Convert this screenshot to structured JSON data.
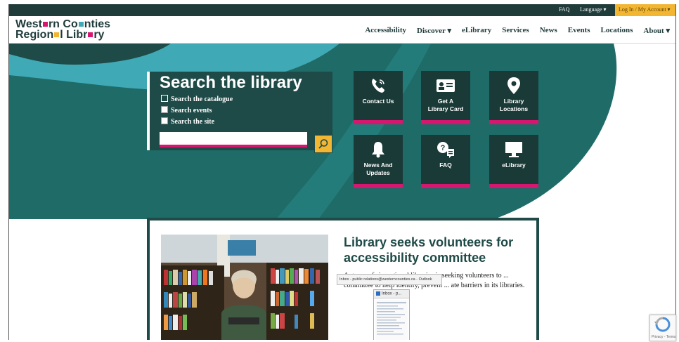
{
  "utility_bar": {
    "faq": "FAQ",
    "language": "Language ▾",
    "login": "Log In / My Account ▾"
  },
  "logo": {
    "line1_a": "West",
    "line1_b": "rn Co",
    "line1_c": "nties",
    "line2_a": "Region",
    "line2_b": "l Libr",
    "line2_c": "ry"
  },
  "nav": [
    "Accessibility",
    "Discover ▾",
    "eLibrary",
    "Services",
    "News",
    "Events",
    "Locations",
    "About ▾"
  ],
  "search": {
    "title": "Search the library",
    "options": [
      "Search the catalogue",
      "Search events",
      "Search the site"
    ],
    "placeholder": ""
  },
  "tiles": [
    {
      "label": "Contact Us",
      "icon": "phone-icon"
    },
    {
      "label": "Get A\nLibrary Card",
      "icon": "id-card-icon"
    },
    {
      "label": "Library\nLocations",
      "icon": "map-pin-icon"
    },
    {
      "label": "News And\nUpdates",
      "icon": "bell-icon"
    },
    {
      "label": "FAQ",
      "icon": "question-chat-icon"
    },
    {
      "label": "eLibrary",
      "icon": "monitor-icon"
    }
  ],
  "news": {
    "headline": "Library seeks volunteers for accessibility committee",
    "body": "A group of six regional libraries is seeking volunteers to ... committee to help identify, prevent ... ate barriers in its libraries."
  },
  "tooltip": "Inbox - public relations@westerncounties.ca - Outlook",
  "taskbar_thumb": {
    "title": "Inbox - p..."
  },
  "recaptcha": {
    "text": "Privacy - Terms"
  },
  "colors": {
    "dark_teal": "#1e4a47",
    "accent_pink": "#d6166f",
    "accent_yellow": "#f2b632",
    "light_teal": "#3fa9b5"
  }
}
